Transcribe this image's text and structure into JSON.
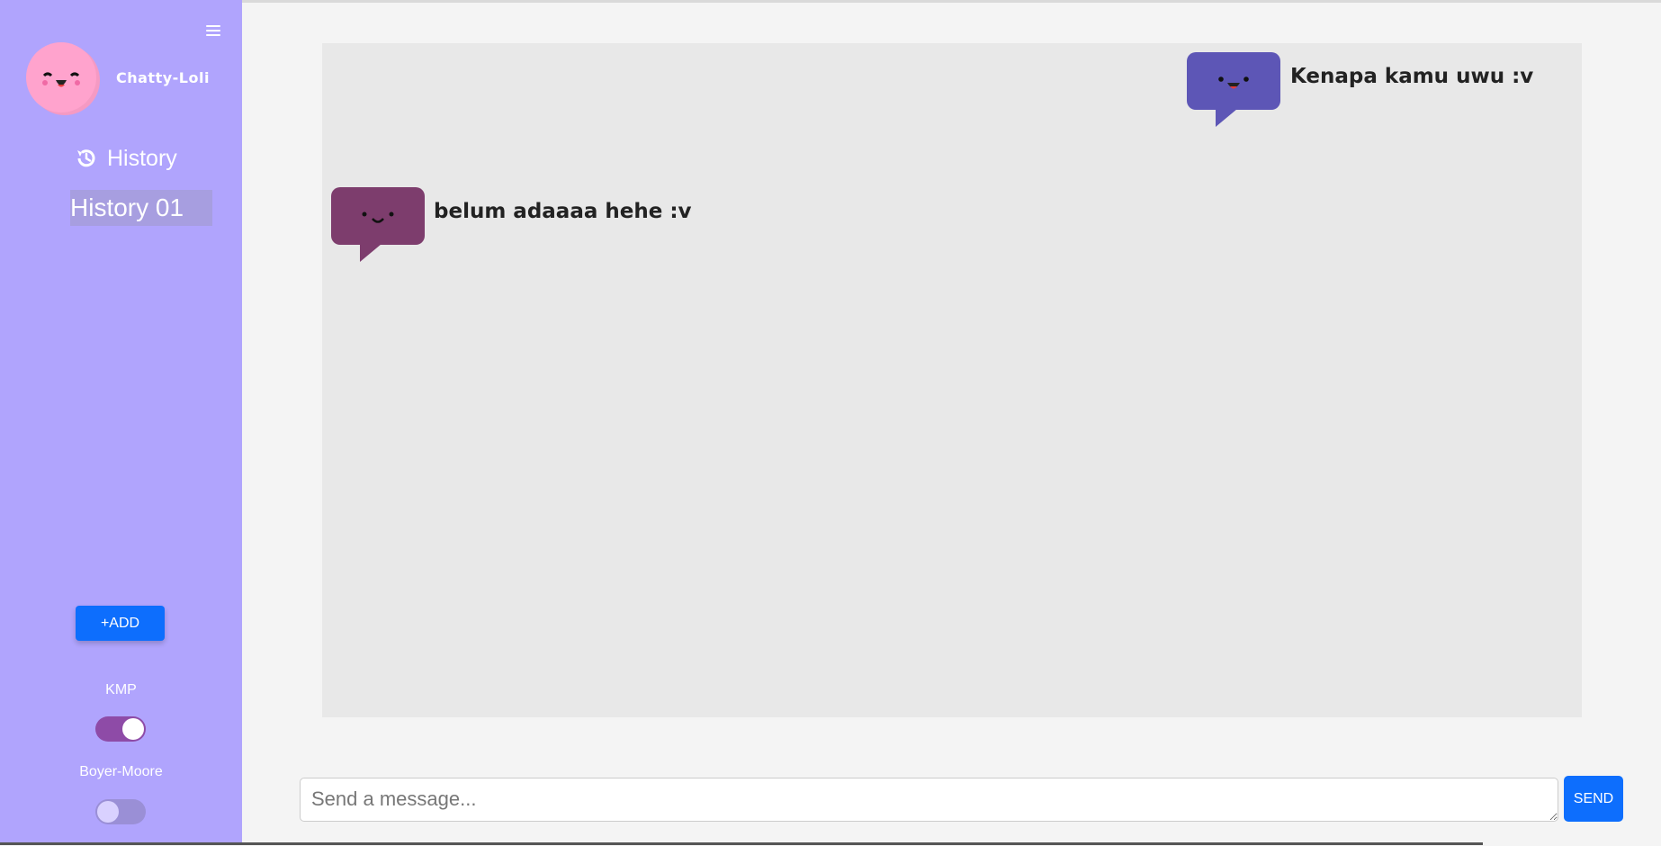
{
  "sidebar": {
    "brand": "Chatty-Loli",
    "history_label": "History",
    "history_items": [
      {
        "label": "History 01",
        "selected": true
      }
    ],
    "add_label": "+ADD",
    "toggles": [
      {
        "label": "KMP",
        "on": true
      },
      {
        "label": "Boyer-Moore",
        "on": false
      }
    ]
  },
  "chat": {
    "messages": [
      {
        "sender": "user",
        "text": "Kenapa kamu uwu :v"
      },
      {
        "sender": "bot",
        "text": "belum adaaaa hehe :v"
      }
    ]
  },
  "composer": {
    "placeholder": "Send a message...",
    "value": "",
    "send_label": "SEND"
  },
  "colors": {
    "sidebar_bg": "#b0a4fd",
    "user_bubble": "#5d56b6",
    "bot_bubble": "#7d3d6d",
    "primary_button": "#0d6efd",
    "toggle_on": "#8e4ba7"
  },
  "icons": {
    "menu": "hamburger-menu-icon",
    "history": "history-clock-icon",
    "avatar": "smiling-face-avatar",
    "user_bubble": "happy-speech-bubble-icon",
    "bot_bubble": "smiling-speech-bubble-icon"
  }
}
